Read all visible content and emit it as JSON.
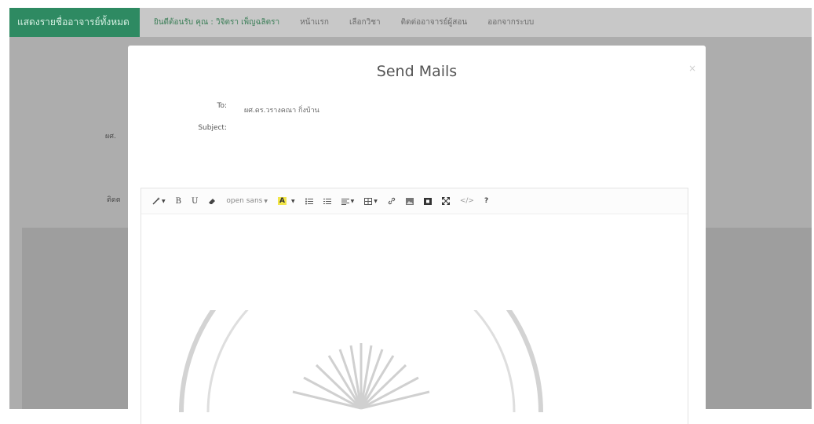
{
  "navbar": {
    "brand": "แสดงรายชื่ออาจารย์ทั้งหมด",
    "welcome": "ยินดีต้อนรับ คุณ : วิจิตรา เพ็ญฉลิตรา",
    "items": [
      "หน้าแรก",
      "เลือกวิชา",
      "ติดต่ออาจารย์ผู้สอน",
      "ออกจากระบบ"
    ]
  },
  "background": {
    "label_name": "ผศ.",
    "label_contact": "ติดต"
  },
  "modal": {
    "title": "Send Mails",
    "close": "×",
    "to_label": "To:",
    "to_value": "ผศ.ดร.วรางคณา กิ่งบ้าน",
    "subject_label": "Subject:"
  },
  "editor": {
    "font_label": "open sans"
  },
  "icons": {
    "style": "magic-wand-icon",
    "bold": "bold-icon",
    "underline": "underline-icon",
    "eraser": "eraser-icon",
    "font_color": "font-color-icon",
    "ul": "unordered-list-icon",
    "ol": "ordered-list-icon",
    "align": "align-icon",
    "table": "table-icon",
    "link": "link-icon",
    "picture": "picture-icon",
    "video": "video-icon",
    "fullscreen": "fullscreen-icon",
    "code": "code-view-icon",
    "help": "help-icon"
  },
  "colors": {
    "brand_bg": "#2e8a62",
    "navbar_bg": "#c8c8c8",
    "overlay": "#adadad",
    "highlight": "#f2e64a"
  }
}
